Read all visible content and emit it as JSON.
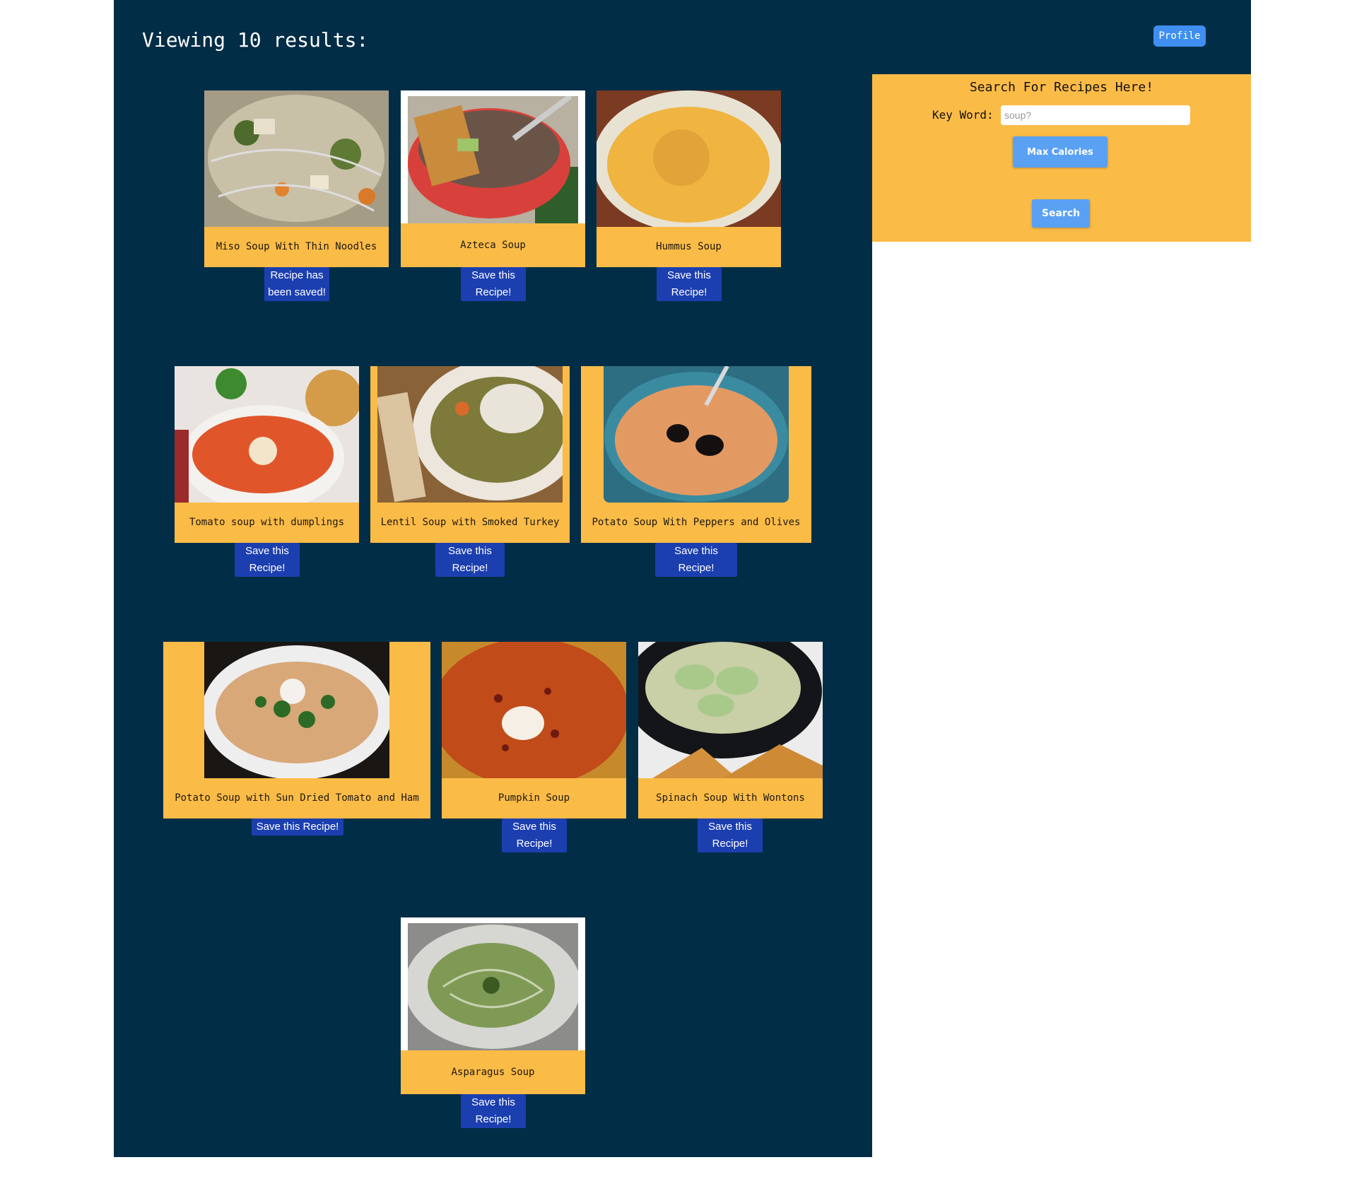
{
  "header": {
    "title": "Viewing 10 results:",
    "profile_label": "Profile"
  },
  "search": {
    "title": "Search For Recipes Here!",
    "keyword_label": "Key Word:",
    "keyword_placeholder": "soup?",
    "max_calories_label": "Max Calories",
    "search_label": "Search"
  },
  "recipes": [
    {
      "name": "Miso Soup With Thin Noodles",
      "save_label": "Recipe has been saved!",
      "image": "miso-soup-photo"
    },
    {
      "name": "Azteca Soup",
      "save_label": "Save this Recipe!",
      "image": "azteca-soup-photo"
    },
    {
      "name": "Hummus Soup",
      "save_label": "Save this Recipe!",
      "image": "hummus-soup-photo"
    },
    {
      "name": "Tomato soup with dumplings",
      "save_label": "Save this Recipe!",
      "image": "tomato-soup-photo"
    },
    {
      "name": "Lentil Soup with Smoked Turkey",
      "save_label": "Save this Recipe!",
      "image": "lentil-soup-photo"
    },
    {
      "name": "Potato Soup With Peppers and Olives",
      "save_label": "Save this Recipe!",
      "image": "potato-olive-soup-photo"
    },
    {
      "name": "Potato Soup with Sun Dried Tomato and Ham",
      "save_label": "Save this Recipe!",
      "image": "potato-ham-soup-photo"
    },
    {
      "name": "Pumpkin Soup",
      "save_label": "Save this Recipe!",
      "image": "pumpkin-soup-photo"
    },
    {
      "name": "Spinach Soup With Wontons",
      "save_label": "Save this Recipe!",
      "image": "spinach-wonton-soup-photo"
    },
    {
      "name": "Asparagus Soup",
      "save_label": "Save this Recipe!",
      "image": "asparagus-soup-photo"
    }
  ],
  "colors": {
    "background": "#022d46",
    "card": "#fbbb47",
    "save_button": "#1c3fb0",
    "action_button": "#5aa1f4",
    "profile_button": "#3e8ff0"
  }
}
